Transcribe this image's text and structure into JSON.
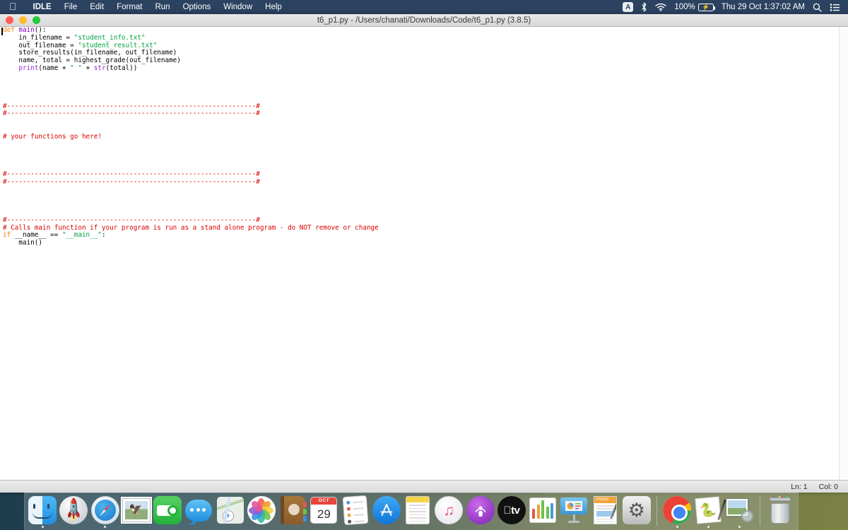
{
  "menubar": {
    "apple_icon": "apple-logo-icon",
    "items": [
      "IDLE",
      "File",
      "Edit",
      "Format",
      "Run",
      "Options",
      "Window",
      "Help"
    ],
    "status": {
      "input_source": "A",
      "bluetooth_icon": "bluetooth-icon",
      "wifi_icon": "wifi-icon",
      "battery_percent": "100%",
      "battery_icon": "battery-charging-icon",
      "datetime": "Thu 29 Oct  1:37:02 AM",
      "search_icon": "search-icon",
      "control_center_icon": "control-center-icon"
    }
  },
  "window": {
    "title": "t6_p1.py - /Users/chanati/Downloads/Code/t6_p1.py (3.8.5)",
    "traffic_lights": [
      "close",
      "minimize",
      "zoom"
    ]
  },
  "editor": {
    "lines": [
      {
        "n": 1,
        "tokens": [
          {
            "t": "def ",
            "c": "kw"
          },
          {
            "t": "main",
            "c": "def"
          },
          {
            "t": "():",
            "c": ""
          }
        ]
      },
      {
        "n": 2,
        "tokens": [
          {
            "t": "    in_filename = ",
            "c": ""
          },
          {
            "t": "\"student_info.txt\"",
            "c": "str"
          }
        ]
      },
      {
        "n": 3,
        "tokens": [
          {
            "t": "    out_filename = ",
            "c": ""
          },
          {
            "t": "\"student_result.txt\"",
            "c": "str"
          }
        ]
      },
      {
        "n": 4,
        "tokens": [
          {
            "t": "    store_results(in_filename, out_filename)",
            "c": ""
          }
        ]
      },
      {
        "n": 5,
        "tokens": [
          {
            "t": "    name, total = highest_grade(out_filename)",
            "c": ""
          }
        ]
      },
      {
        "n": 6,
        "tokens": [
          {
            "t": "    ",
            "c": ""
          },
          {
            "t": "print",
            "c": "bi"
          },
          {
            "t": "(name + ",
            "c": ""
          },
          {
            "t": "\" \"",
            "c": "str"
          },
          {
            "t": " + ",
            "c": ""
          },
          {
            "t": "str",
            "c": "bi"
          },
          {
            "t": "(total))",
            "c": ""
          }
        ]
      },
      {
        "n": 7,
        "tokens": []
      },
      {
        "n": 8,
        "tokens": []
      },
      {
        "n": 9,
        "tokens": []
      },
      {
        "n": 10,
        "tokens": []
      },
      {
        "n": 11,
        "tokens": [
          {
            "t": "#---------------------------------------------------------------#",
            "c": "cmt"
          }
        ]
      },
      {
        "n": 12,
        "tokens": [
          {
            "t": "#---------------------------------------------------------------#",
            "c": "cmt"
          }
        ]
      },
      {
        "n": 13,
        "tokens": []
      },
      {
        "n": 14,
        "tokens": []
      },
      {
        "n": 15,
        "tokens": [
          {
            "t": "# your functions go here!",
            "c": "cmt"
          }
        ]
      },
      {
        "n": 16,
        "tokens": []
      },
      {
        "n": 17,
        "tokens": []
      },
      {
        "n": 18,
        "tokens": []
      },
      {
        "n": 19,
        "tokens": []
      },
      {
        "n": 20,
        "tokens": [
          {
            "t": "#---------------------------------------------------------------#",
            "c": "cmt"
          }
        ]
      },
      {
        "n": 21,
        "tokens": [
          {
            "t": "#---------------------------------------------------------------#",
            "c": "cmt"
          }
        ]
      },
      {
        "n": 22,
        "tokens": []
      },
      {
        "n": 23,
        "tokens": []
      },
      {
        "n": 24,
        "tokens": []
      },
      {
        "n": 25,
        "tokens": []
      },
      {
        "n": 26,
        "tokens": [
          {
            "t": "#---------------------------------------------------------------#",
            "c": "cmt"
          }
        ]
      },
      {
        "n": 27,
        "tokens": [
          {
            "t": "# Calls main function if your program is run as a stand alone program - do NOT remove or change",
            "c": "cmt"
          }
        ]
      },
      {
        "n": 28,
        "tokens": [
          {
            "t": "if",
            "c": "kw"
          },
          {
            "t": " __name__ == ",
            "c": ""
          },
          {
            "t": "\"__main__\"",
            "c": "str"
          },
          {
            "t": ":",
            "c": ""
          }
        ]
      },
      {
        "n": 29,
        "tokens": [
          {
            "t": "    main()",
            "c": ""
          }
        ]
      }
    ]
  },
  "statusbar": {
    "line": "Ln: 1",
    "col": "Col: 0"
  },
  "dock": {
    "items": [
      {
        "name": "finder",
        "label": "Finder",
        "running": true
      },
      {
        "name": "launchpad",
        "label": "Launchpad",
        "running": false
      },
      {
        "name": "safari",
        "label": "Safari",
        "running": true
      },
      {
        "name": "mail",
        "label": "Mail",
        "running": false
      },
      {
        "name": "facetime",
        "label": "FaceTime",
        "running": false
      },
      {
        "name": "messages",
        "label": "Messages",
        "running": false
      },
      {
        "name": "maps",
        "label": "Maps",
        "running": false
      },
      {
        "name": "photos",
        "label": "Photos",
        "running": false
      },
      {
        "name": "contacts",
        "label": "Contacts",
        "running": false
      },
      {
        "name": "calendar",
        "label": "Calendar",
        "running": false,
        "month": "OCT",
        "day": "29"
      },
      {
        "name": "reminders",
        "label": "Reminders",
        "running": false
      },
      {
        "name": "app-store",
        "label": "App Store",
        "running": false
      },
      {
        "name": "notes",
        "label": "Notes",
        "running": false
      },
      {
        "name": "music",
        "label": "Music",
        "running": false
      },
      {
        "name": "podcasts",
        "label": "Podcasts",
        "running": false
      },
      {
        "name": "apple-tv",
        "label": "TV",
        "running": false
      },
      {
        "name": "numbers",
        "label": "Numbers",
        "running": false
      },
      {
        "name": "keynote",
        "label": "Keynote",
        "running": false
      },
      {
        "name": "pages",
        "label": "Pages",
        "running": false
      },
      {
        "name": "system-preferences",
        "label": "System Preferences",
        "running": false
      },
      {
        "name": "separator-1",
        "label": "",
        "running": false
      },
      {
        "name": "google-chrome",
        "label": "Google Chrome",
        "running": true
      },
      {
        "name": "idle",
        "label": "IDLE",
        "running": true
      },
      {
        "name": "preview",
        "label": "Preview",
        "running": true
      },
      {
        "name": "separator-2",
        "label": "",
        "running": false
      },
      {
        "name": "trash",
        "label": "Trash",
        "running": false
      }
    ],
    "apple_tv_text": "tv"
  },
  "colors": {
    "menubar_bg": "#2b4260",
    "keyword": "#ff7700",
    "definition": "#7d00c4",
    "builtin": "#9c29d1",
    "string": "#00a33f",
    "comment": "#dd0000"
  }
}
